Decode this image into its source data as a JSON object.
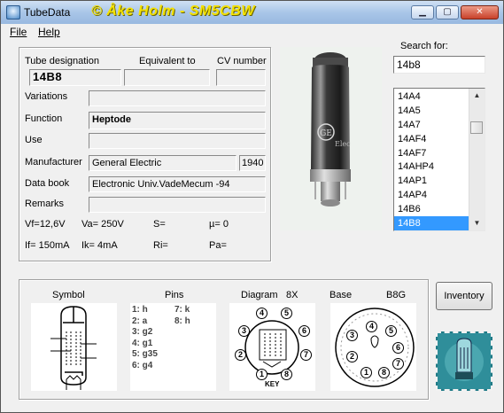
{
  "window": {
    "title": "TubeData",
    "credit": "© Åke Holm - SM5CBW",
    "controls": {
      "minimize": "▁",
      "maximize": "▢",
      "close": "✕"
    }
  },
  "menu": {
    "file": "File",
    "help": "Help"
  },
  "fields": {
    "tube_designation": {
      "label": "Tube designation",
      "value": "14B8"
    },
    "equivalent_to": {
      "label": "Equivalent to",
      "value": ""
    },
    "cv_number": {
      "label": "CV number",
      "value": ""
    },
    "variations": {
      "label": "Variations",
      "value": ""
    },
    "function": {
      "label": "Function",
      "value": "Heptode"
    },
    "use": {
      "label": "Use",
      "value": ""
    },
    "manufacturer": {
      "label": "Manufacturer",
      "value": "General Electric",
      "year": "1940"
    },
    "data_book": {
      "label": "Data book",
      "value": "Electronic Univ.VadeMecum -94"
    },
    "remarks": {
      "label": "Remarks",
      "value": ""
    }
  },
  "params": {
    "vf": "Vf=12,6V",
    "va": "Va= 250V",
    "s": "S=",
    "mu": "µ=   0",
    "if": "If= 150mA",
    "ik": "Ik=  4mA",
    "ri": "Ri=",
    "pa": "Pa="
  },
  "search": {
    "label": "Search for:",
    "value": "14b8",
    "items": [
      "14A4",
      "14A5",
      "14A7",
      "14AF4",
      "14AF7",
      "14AHP4",
      "14AP1",
      "14AP4",
      "14B6",
      "14B8"
    ],
    "selected_index": 9
  },
  "bottom": {
    "symbol_label": "Symbol",
    "pins_label": "Pins",
    "diagram_label": "Diagram",
    "diagram_code": "8X",
    "base_label": "Base",
    "base_code": "B8G",
    "pins_col1": [
      "1: h",
      "2: a",
      "3: g2",
      "4: g1",
      "5: g35",
      "6: g4"
    ],
    "pins_col2": [
      "7: k",
      "8: h"
    ],
    "diagram_key": "KEY"
  },
  "buttons": {
    "inventory": "Inventory"
  },
  "photo": {
    "logo_text": "GE",
    "brand_text": "Elec"
  },
  "colors": {
    "selection": "#3399ff",
    "credit": "#f5e200"
  }
}
